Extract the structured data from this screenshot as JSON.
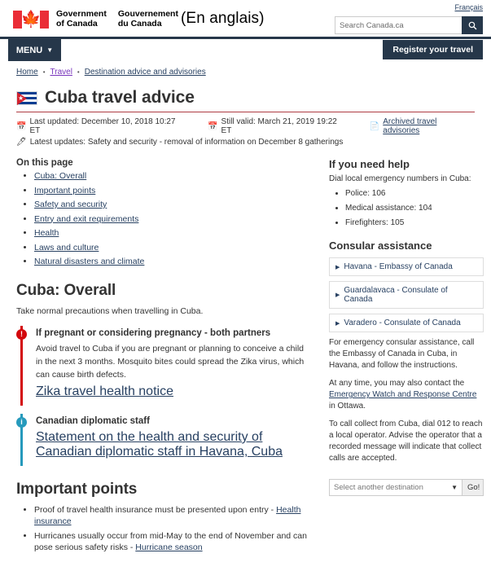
{
  "header": {
    "lang_link": "Français",
    "wordmark_en_line1": "Government",
    "wordmark_en_line2": "of Canada",
    "wordmark_fr_line1": "Gouvernement",
    "wordmark_fr_line2": "du Canada",
    "annotation": "(En anglais)",
    "search_placeholder": "Search Canada.ca",
    "search_icon": "search-icon",
    "menu_label": "MENU",
    "register_label": "Register your travel"
  },
  "breadcrumb": {
    "items": [
      {
        "label": "Home"
      },
      {
        "label": "Travel"
      },
      {
        "label": "Destination advice and advisories"
      }
    ],
    "separator": "•"
  },
  "page": {
    "title": "Cuba travel advice",
    "flag_icon": "cuba-flag-icon",
    "last_updated_icon": "calendar-icon",
    "last_updated": "Last updated: December 10, 2018 10:27 ET",
    "still_valid_icon": "calendar-check-icon",
    "still_valid": "Still valid: March 21, 2019 19:22 ET",
    "archived_icon": "document-icon",
    "archived_link": "Archived travel advisories",
    "latest_updates_icon": "pencil-icon",
    "latest_updates": "Latest updates: Safety and security - removal of information on December 8 gatherings"
  },
  "on_this_page": {
    "heading": "On this page",
    "links": [
      "Cuba: Overall",
      "Important points",
      "Safety and security",
      "Entry and exit requirements",
      "Health",
      "Laws and culture",
      "Natural disasters and climate"
    ]
  },
  "overall": {
    "heading": "Cuba: Overall",
    "intro": "Take normal precautions when travelling in Cuba.",
    "alerts": [
      {
        "type": "danger",
        "badge": "!",
        "icon": "alert-exclamation-icon",
        "title": "If pregnant or considering pregnancy - both partners",
        "body": "Avoid travel to Cuba if you are pregnant or planning to conceive a child in the next 3 months. Mosquito bites could spread the Zika virus, which can cause birth defects.",
        "link": "Zika travel health notice"
      },
      {
        "type": "info",
        "badge": "i",
        "icon": "info-circle-icon",
        "title": "Canadian diplomatic staff",
        "body": "",
        "link": "Statement on the health and security of Canadian diplomatic staff in Havana, Cuba"
      }
    ]
  },
  "important_points": {
    "heading": "Important points",
    "items": [
      {
        "text": "Proof of travel health insurance must be presented upon entry - ",
        "link": "Health insurance"
      },
      {
        "text": "Hurricanes usually occur from mid-May to the end of November and can pose serious safety risks - ",
        "link": "Hurricane season"
      }
    ]
  },
  "sidebar": {
    "help_heading": "If you need help",
    "dial_intro": "Dial local emergency numbers in Cuba:",
    "emergency_numbers": [
      "Police: 106",
      "Medical assistance: 104",
      "Firefighters: 105"
    ],
    "consular_heading": "Consular assistance",
    "consular_offices": [
      "Havana - Embassy of Canada",
      "Guardalavaca - Consulate of Canada",
      "Varadero - Consulate of Canada"
    ],
    "accordion_icon": "triangle-right-icon",
    "paragraphs": [
      {
        "pre": "For emergency consular assistance, call the Embassy of Canada in Cuba, in Havana, and follow the instructions.",
        "link": "",
        "post": ""
      },
      {
        "pre": "At any time, you may also contact the ",
        "link": "Emergency Watch and Response Centre",
        "post": " in Ottawa."
      },
      {
        "pre": "To call collect from Cuba, dial 012 to reach a local operator. Advise the operator that a recorded message will indicate that collect calls are accepted.",
        "link": "",
        "post": ""
      }
    ],
    "destination_placeholder": "Select another destination",
    "destination_arrow_icon": "chevron-down-icon",
    "go_label": "Go!"
  },
  "colors": {
    "header_navy": "#26374a",
    "title_rule_red": "#af3c43",
    "alert_danger": "#d3080c",
    "alert_info": "#269abc",
    "link": "#284162"
  }
}
